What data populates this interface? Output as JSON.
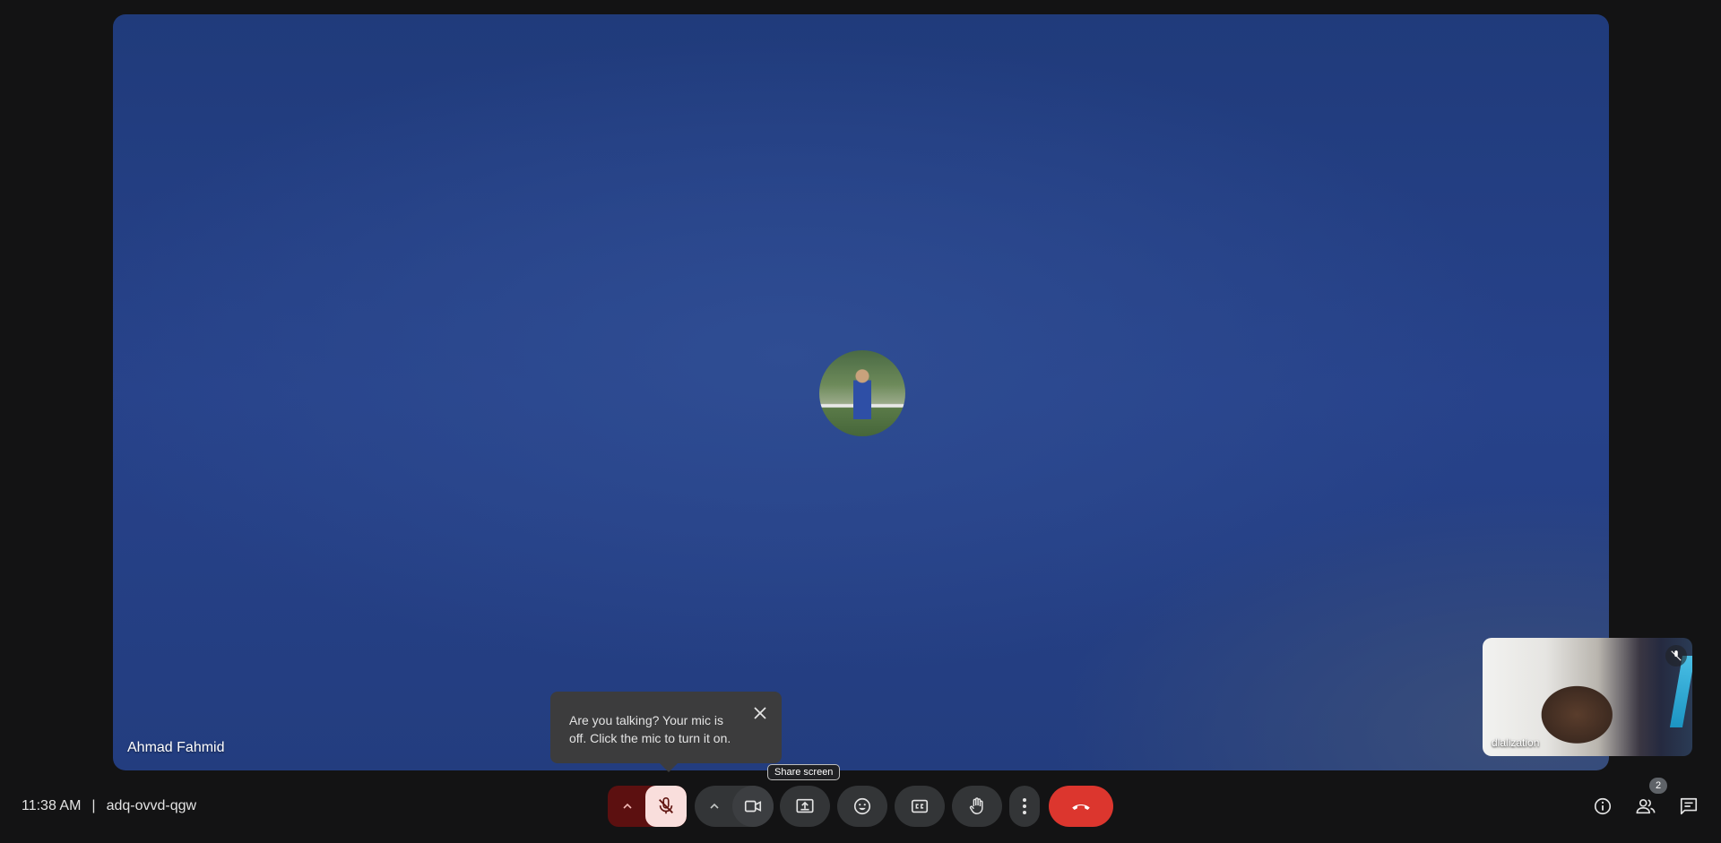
{
  "main_tile": {
    "participant_name": "Ahmad Fahmid"
  },
  "self_view": {
    "name": "dlalization"
  },
  "mic_hint": {
    "message": "Are you talking? Your mic is off. Click the mic to turn it on."
  },
  "hover_tooltip": "Share screen",
  "meeting": {
    "time": "11:38 AM",
    "separator": "|",
    "code": "adq-ovvd-qgw"
  },
  "people": {
    "count": "2"
  },
  "colors": {
    "leave_button": "#dc362e",
    "mic_off_bg": "#f9dedc",
    "mic_off_group": "#5c1010",
    "background": "#131314"
  },
  "icons": {
    "mic": "mic-off-icon",
    "camera": "videocam-icon",
    "share": "present-to-all-icon",
    "emoji": "emoji-icon",
    "captions": "closed-caption-icon",
    "hand": "raise-hand-icon",
    "more": "more-vert-icon",
    "leave": "call-end-icon",
    "info": "info-icon",
    "people": "people-icon",
    "chat": "chat-icon"
  }
}
